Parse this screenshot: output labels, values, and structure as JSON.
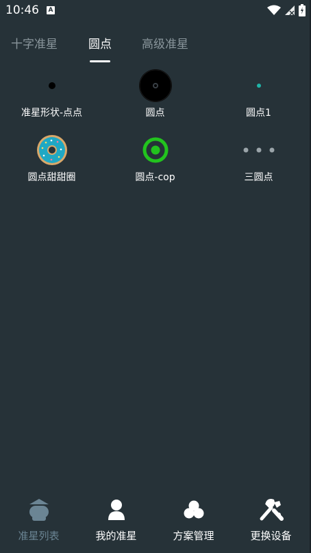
{
  "status": {
    "time": "10:46",
    "notification_icon": "A"
  },
  "tabs": [
    {
      "label": "十字准星"
    },
    {
      "label": "圆点"
    },
    {
      "label": "高级准星"
    }
  ],
  "items": [
    {
      "label": "准星形状-点点",
      "icon": "small-black-dot"
    },
    {
      "label": "圆点",
      "icon": "black-ring-dot"
    },
    {
      "label": "圆点1",
      "icon": "teal-dot"
    },
    {
      "label": "圆点甜甜圈",
      "icon": "donut"
    },
    {
      "label": "圆点-cop",
      "icon": "green-target"
    },
    {
      "label": "三圆点",
      "icon": "three-dots"
    }
  ],
  "nav": [
    {
      "label": "准星列表",
      "icon": "crosshair-list-icon"
    },
    {
      "label": "我的准星",
      "icon": "user-icon"
    },
    {
      "label": "方案管理",
      "icon": "cluster-icon"
    },
    {
      "label": "更换设备",
      "icon": "tools-icon"
    }
  ],
  "colors": {
    "background": "#263238",
    "active_nav": "#6b8594",
    "teal_dot": "#1fb5a8",
    "green_target": "#22c31e",
    "donut": "#1fa8c4"
  }
}
